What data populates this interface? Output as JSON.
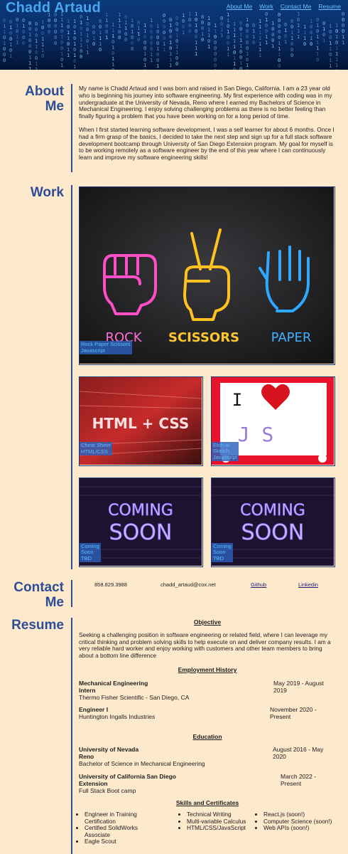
{
  "header": {
    "brand": "Chadd Artaud",
    "nav": [
      "About Me",
      "Work",
      "Contact Me",
      "Resume"
    ]
  },
  "about": {
    "heading_line1": "About",
    "heading_line2": "Me",
    "p1": "My name is Chadd Artaud and I was born and raised in San Diego, California. I am a 23 year old who is beginning his journey into software engineering. My first experience with coding was in my undergraduate at the University of Nevada, Reno where I earned my Bachelors of Science in Mechanical Engineering. I enjoy solving challenging problems as there is no better feeling than finally figuring a problem that you have been working on for a long period of time.",
    "p2": "When I first started learning software development, I was a self learner for about 6 months. Once I had a firm grasp of the basics, I decided to take the next step and sign up for a full stack software development bootcamp through University of San Diego Extension program. My goal for myself is to be working remotely as a software engineer by the end of this year where I can continuously learn and improve my software engineering skills!"
  },
  "work": {
    "heading": "Work",
    "projects": [
      {
        "name": "Rock Paper Scissors",
        "tech": "Javascript",
        "image_words": [
          "ROCK",
          "SCISSORS",
          "PAPER"
        ]
      },
      {
        "name": "Cheat Sheet",
        "tech": "HTML/CSS",
        "image_text": "HTML + CSS"
      },
      {
        "name_line1": "Etch-A-",
        "name_line2": "Sketch",
        "tech": "Javascript",
        "image_i": "I",
        "image_js": "J S"
      },
      {
        "name_line1": "Coming",
        "name_line2": "Soon",
        "tech": "TBD",
        "image_l1": "COMING",
        "image_l2": "SOON"
      },
      {
        "name_line1": "Coming",
        "name_line2": "Soon",
        "tech": "TBD",
        "image_l1": "COMING",
        "image_l2": "SOON"
      }
    ]
  },
  "contact": {
    "heading_line1": "Contact",
    "heading_line2": "Me",
    "phone": "858.829.3988",
    "email": "chadd_artaud@cox.net",
    "github": "Github",
    "linkedin": "Linkedin"
  },
  "resume": {
    "heading": "Resume",
    "objective_heading": "Objective",
    "objective": "Seeking a challenging position in software engineering or related field, where I can leverage my critical thinking and problem solving skills to help execute on and deliver company results. I am a very reliable hard worker and enjoy working with customers and other team members to bring about a bottom line difference",
    "employment_heading": "Employment History",
    "jobs": [
      {
        "title": "Mechanical Engineering Intern",
        "company": "Thermo Fisher Scientific - San Diego, CA",
        "dates": "May 2019 - August 2019"
      },
      {
        "title": "Engineer I",
        "company": "Huntington Ingalls Industries",
        "dates": "November 2020 - Present"
      }
    ],
    "education_heading": "Education",
    "education": [
      {
        "school": "University of Nevada Reno",
        "degree": "Bachelor of Science in Mechanical Engineering",
        "dates": "August 2016 - May 2020"
      },
      {
        "school": "University of California San Diego Extension",
        "degree": "Full Stack Boot camp",
        "dates": "March 2022 - Present"
      }
    ],
    "skills_heading": "Skills and Certificates",
    "skills_col1": [
      "Engineer in Training Certification",
      "Certified SolidWorks Associate",
      "Eagle Scout"
    ],
    "skills_col2": [
      "Technical Writing",
      "Multi-variable Calculus",
      "HTML/CSS/JavaScript"
    ],
    "skills_col3": [
      "React.js (soon!)",
      "Computer Science (soon!)",
      "Web APIs (soon!)"
    ]
  }
}
